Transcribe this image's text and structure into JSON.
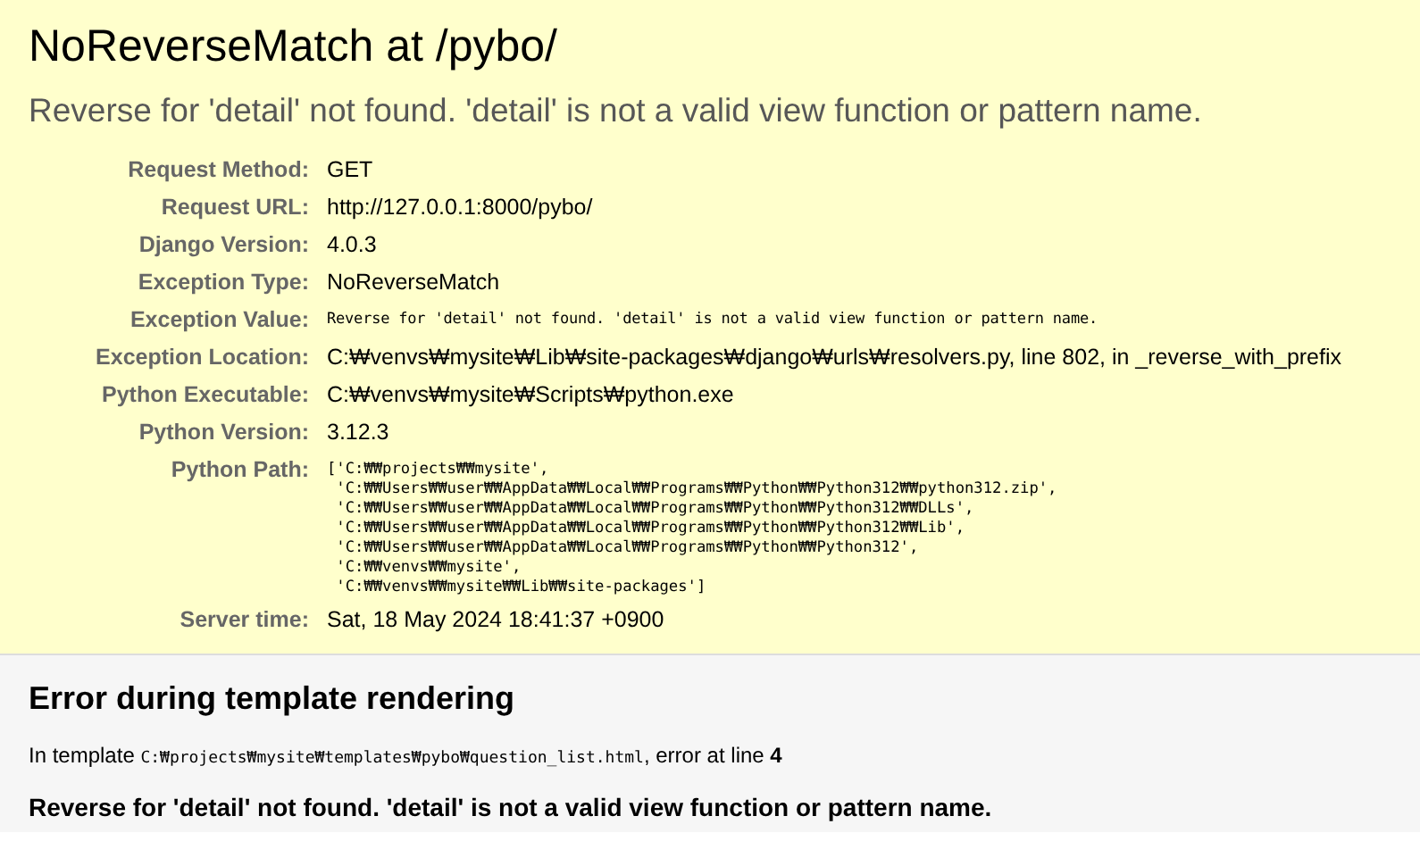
{
  "title": "NoReverseMatch at /pybo/",
  "message": "Reverse for 'detail' not found. 'detail' is not a valid view function or pattern name.",
  "meta": [
    {
      "label": "Request Method:",
      "value": "GET",
      "kind": "text"
    },
    {
      "label": "Request URL:",
      "value": "http://127.0.0.1:8000/pybo/",
      "kind": "text"
    },
    {
      "label": "Django Version:",
      "value": "4.0.3",
      "kind": "text"
    },
    {
      "label": "Exception Type:",
      "value": "NoReverseMatch",
      "kind": "text"
    },
    {
      "label": "Exception Value:",
      "value": "Reverse for 'detail' not found. 'detail' is not a valid view function or pattern name.",
      "kind": "code"
    },
    {
      "label": "Exception Location:",
      "value": "C:₩venvs₩mysite₩Lib₩site-packages₩django₩urls₩resolvers.py, line 802, in _reverse_with_prefix",
      "kind": "text"
    },
    {
      "label": "Python Executable:",
      "value": "C:₩venvs₩mysite₩Scripts₩python.exe",
      "kind": "text"
    },
    {
      "label": "Python Version:",
      "value": "3.12.3",
      "kind": "text"
    },
    {
      "label": "Python Path:",
      "lines": [
        "['C:₩₩projects₩₩mysite',",
        " 'C:₩₩Users₩₩user₩₩AppData₩₩Local₩₩Programs₩₩Python₩₩Python312₩₩python312.zip',",
        " 'C:₩₩Users₩₩user₩₩AppData₩₩Local₩₩Programs₩₩Python₩₩Python312₩₩DLLs',",
        " 'C:₩₩Users₩₩user₩₩AppData₩₩Local₩₩Programs₩₩Python₩₩Python312₩₩Lib',",
        " 'C:₩₩Users₩₩user₩₩AppData₩₩Local₩₩Programs₩₩Python₩₩Python312',",
        " 'C:₩₩venvs₩₩mysite',",
        " 'C:₩₩venvs₩₩mysite₩₩Lib₩₩site-packages']"
      ],
      "kind": "pre"
    },
    {
      "label": "Server time:",
      "value": "Sat, 18 May 2024 18:41:37 +0900",
      "kind": "text"
    }
  ],
  "template_error": {
    "heading": "Error during template rendering",
    "intro": "In template",
    "path": "C:₩projects₩mysite₩templates₩pybo₩question_list.html",
    "middle": ", error at line",
    "line": "4",
    "message": "Reverse for 'detail' not found. 'detail' is not a valid view function or pattern name."
  }
}
